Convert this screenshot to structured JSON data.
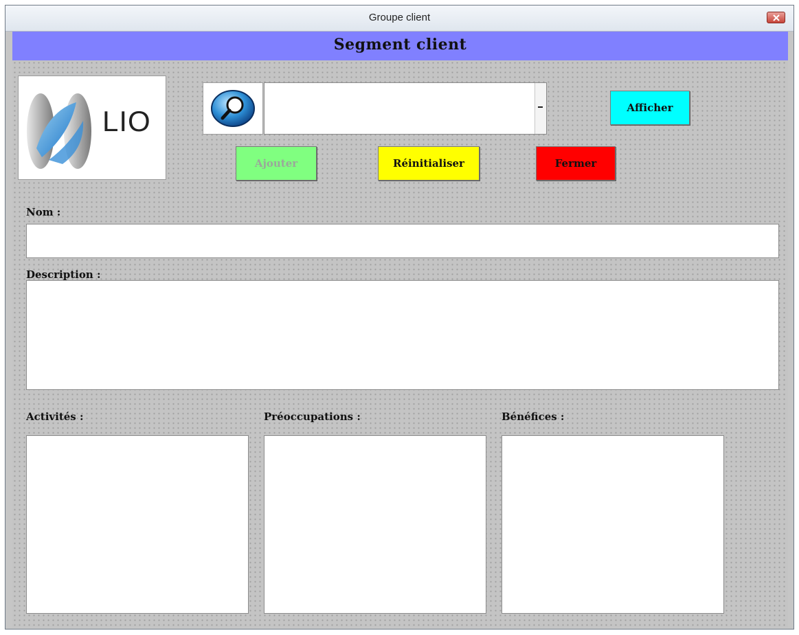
{
  "window": {
    "title": "Groupe client"
  },
  "header": {
    "title": "Segment client"
  },
  "logo": {
    "name": "LIO",
    "tagline_1": "",
    "tagline_2": ""
  },
  "search": {
    "value": "",
    "placeholder": ""
  },
  "buttons": {
    "afficher": "Afficher",
    "ajouter": "Ajouter",
    "reinitialiser": "Réinitialiser",
    "fermer": "Fermer"
  },
  "fields": {
    "nom": {
      "label": "Nom :",
      "value": ""
    },
    "description": {
      "label": "Description :",
      "value": ""
    },
    "activites": {
      "label": "Activités :",
      "value": ""
    },
    "preoccupations": {
      "label": "Préoccupations :",
      "value": ""
    },
    "benefices": {
      "label": "Bénéfices :",
      "value": ""
    }
  },
  "colors": {
    "header_band": "#8080ff",
    "afficher": "#00ffff",
    "ajouter": "#80ff80",
    "reinitialiser": "#ffff00",
    "fermer": "#ff0000"
  }
}
